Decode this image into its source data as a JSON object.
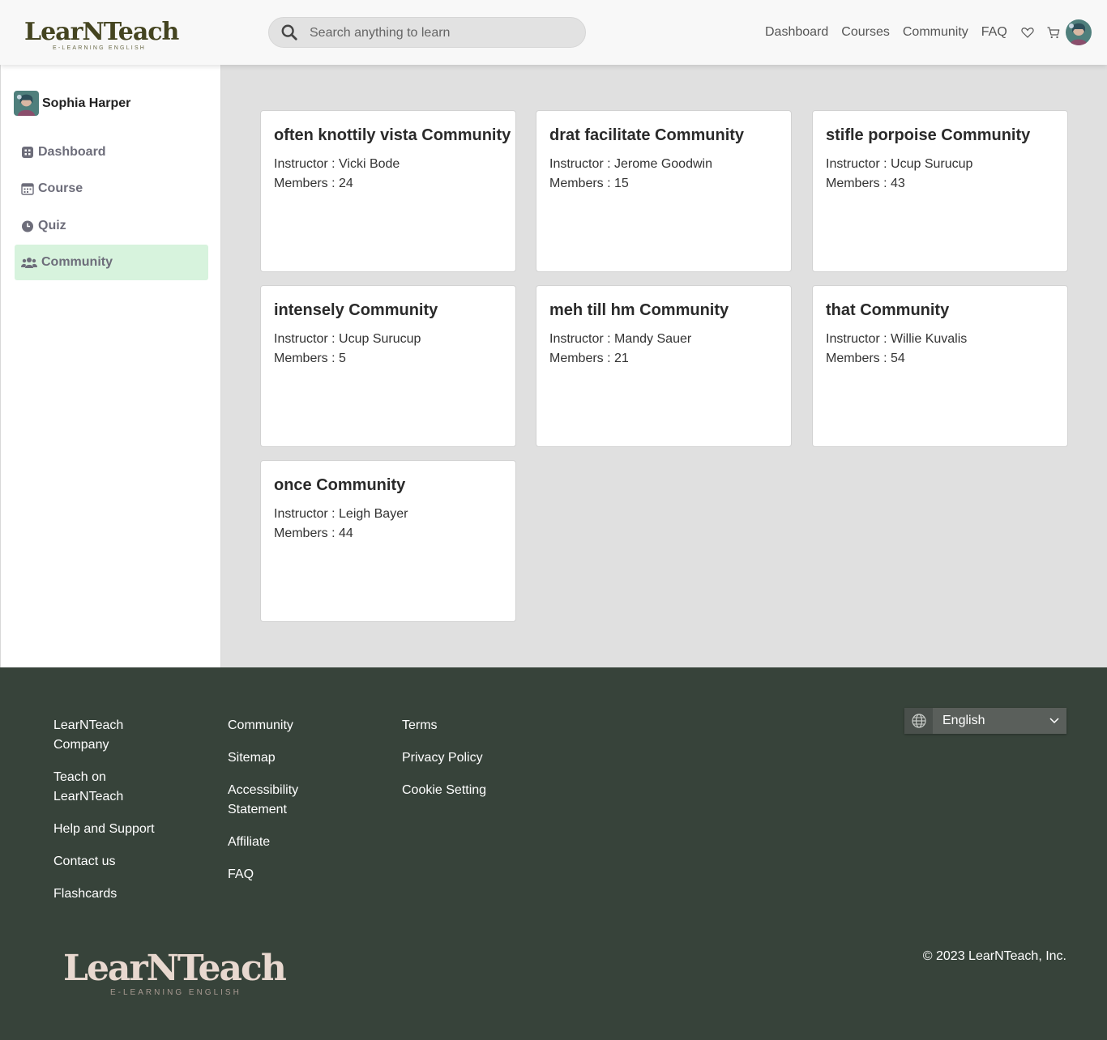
{
  "header": {
    "logo_text": "LearNTeach",
    "logo_sub": "E-LEARNING ENGLISH",
    "search_placeholder": "Search anything to learn",
    "nav": [
      "Dashboard",
      "Courses",
      "Community",
      "FAQ"
    ],
    "icons": [
      "heart-icon",
      "cart-icon"
    ]
  },
  "sidebar": {
    "user_name": "Sophia Harper",
    "items": [
      {
        "label": "Dashboard",
        "icon": "grid-icon"
      },
      {
        "label": "Course",
        "icon": "calendar-icon"
      },
      {
        "label": "Quiz",
        "icon": "clock-icon"
      },
      {
        "label": "Community",
        "icon": "users-icon",
        "active": true
      }
    ],
    "active_color": "#d7f3dd"
  },
  "communities": [
    {
      "title": "often knottily vista Community",
      "instructor": "Instructor : Vicki Bode",
      "members": "Members : 24"
    },
    {
      "title": "drat facilitate Community",
      "instructor": "Instructor : Jerome Goodwin",
      "members": "Members : 15"
    },
    {
      "title": "stifle porpoise Community",
      "instructor": "Instructor : Ucup Surucup",
      "members": "Members : 43"
    },
    {
      "title": "intensely Community",
      "instructor": "Instructor : Ucup Surucup",
      "members": "Members : 5"
    },
    {
      "title": "meh till hm Community",
      "instructor": "Instructor : Mandy Sauer",
      "members": "Members : 21"
    },
    {
      "title": "that Community",
      "instructor": "Instructor : Willie Kuvalis",
      "members": "Members : 54"
    },
    {
      "title": "once Community",
      "instructor": "Instructor : Leigh Bayer",
      "members": "Members : 44"
    }
  ],
  "footer": {
    "col1": [
      "LearNTeach Company",
      "Teach on LearNTeach",
      "Help and Support",
      "Contact us",
      "Flashcards"
    ],
    "col2": [
      "Community",
      "Sitemap",
      "Accessibility Statement",
      "Affiliate",
      "FAQ"
    ],
    "col3": [
      "Terms",
      "Privacy Policy",
      "Cookie Setting"
    ],
    "language": "English",
    "logo_text": "LearNTeach",
    "logo_sub": "E-LEARNING ENGLISH",
    "copyright": "© 2023 LearNTeach, Inc.",
    "bg_color": "#37433a"
  }
}
